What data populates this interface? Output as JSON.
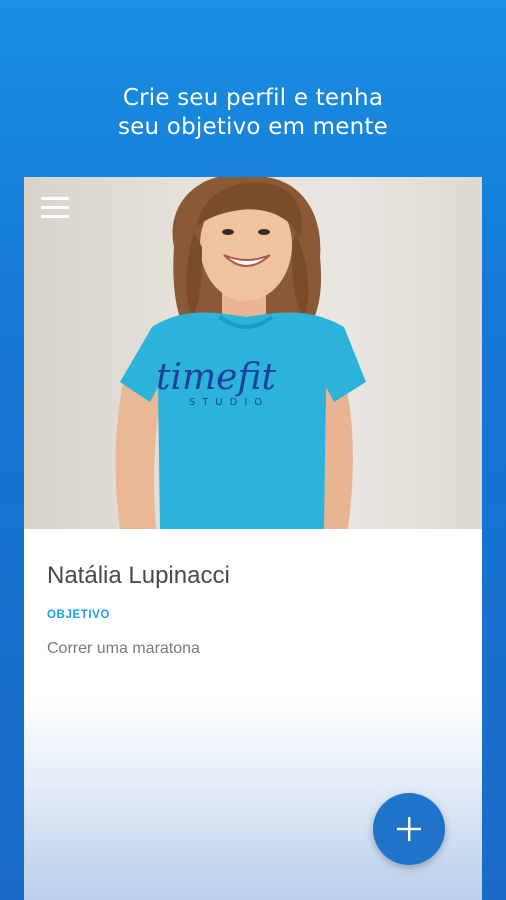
{
  "headline": {
    "line1": "Crie seu perfil e tenha",
    "line2": "seu objetivo em mente"
  },
  "profile": {
    "name": "Natália Lupinacci",
    "goal_label": "OBJETIVO",
    "goal_value": "Correr uma maratona",
    "shirt_logo": "timefit",
    "shirt_sub": "STUDIO"
  },
  "icons": {
    "menu": "hamburger-menu-icon",
    "fab": "plus-icon"
  },
  "colors": {
    "background": "#1a7fd9",
    "accent": "#1e9be6",
    "fab": "#1f73c9",
    "shirt": "#2bb3da"
  }
}
